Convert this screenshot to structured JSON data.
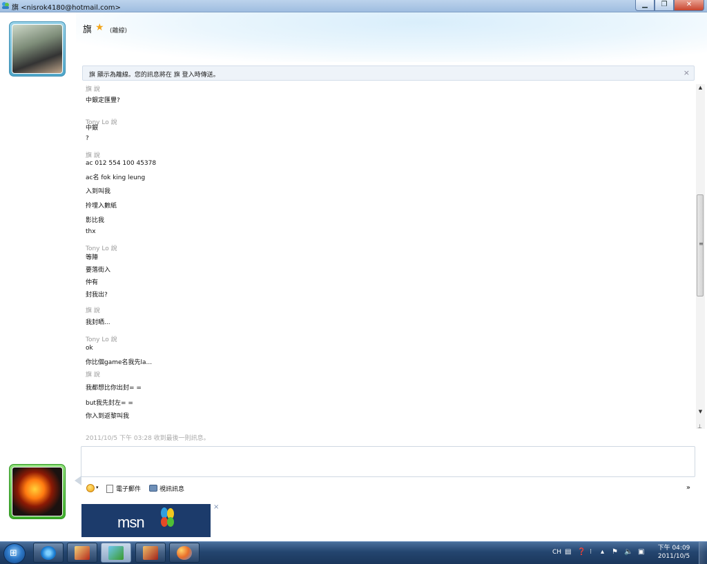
{
  "window": {
    "title": "旗 <nisrok4180@hotmail.com>",
    "minimize_label": "▁",
    "maximize_label": "❐",
    "close_label": "✕"
  },
  "contact": {
    "name": "旗",
    "status": "(離線)"
  },
  "infobar": {
    "message": "旗 顯示為離線。您的訊息將在 旗 登入時傳送。",
    "close_label": "×"
  },
  "conversation": [
    {
      "kind": "sender",
      "text": "旗 說"
    },
    {
      "kind": "text",
      "text": "中銀定匯豐?"
    },
    {
      "kind": "sender",
      "text": "Tony Lo 說"
    },
    {
      "kind": "text",
      "text": "中銀"
    },
    {
      "kind": "text",
      "text": "?"
    },
    {
      "kind": "sender",
      "text": "旗 說"
    },
    {
      "kind": "text",
      "text": "ac 012 554 100 45378"
    },
    {
      "kind": "text",
      "text": "ac名 fok king leung"
    },
    {
      "kind": "text",
      "text": "入到叫我"
    },
    {
      "kind": "text",
      "text": "拎埋入數紙"
    },
    {
      "kind": "text",
      "text": "影比我"
    },
    {
      "kind": "text",
      "text": "thx"
    },
    {
      "kind": "sender",
      "text": "Tony Lo 說"
    },
    {
      "kind": "text",
      "text": "等陣"
    },
    {
      "kind": "text",
      "text": "要落街入"
    },
    {
      "kind": "text",
      "text": "仲有"
    },
    {
      "kind": "text",
      "text": "封我出?"
    },
    {
      "kind": "sender",
      "text": "旗 說"
    },
    {
      "kind": "text",
      "text": "我封晒..."
    },
    {
      "kind": "sender",
      "text": "Tony Lo 說"
    },
    {
      "kind": "text",
      "text": "ok"
    },
    {
      "kind": "text",
      "text": "你比個game名我先la..."
    },
    {
      "kind": "sender",
      "text": "旗 說"
    },
    {
      "kind": "text",
      "text": "我都想比你出封= ="
    },
    {
      "kind": "text",
      "text": "but我先封左= ="
    },
    {
      "kind": "text",
      "text": "你入到返黎叫我"
    }
  ],
  "scrollbar": {
    "up_arrow": "▲",
    "down_arrow": "▼",
    "grip": "≡",
    "end": "⊥"
  },
  "last_message": "2011/10/5 下午 03:28 收到最後一則訊息。",
  "input": {
    "value": ""
  },
  "toolbar": {
    "dropdown_glyph": "▾",
    "email_label": "電子郵件",
    "video_label": "視訊訊息",
    "more_label": "»"
  },
  "ad": {
    "logo_text": "msn",
    "close_label": "×"
  },
  "taskbar": {
    "start_glyph": "⊞",
    "lang": "CH",
    "clock_time": "下午 04:09",
    "clock_date": "2011/10/5"
  },
  "colors": {
    "contact_frame": "#4fa6c8",
    "me_frame": "#3fae2c",
    "taskbar": "#24456f",
    "star": "#f2a51a"
  }
}
